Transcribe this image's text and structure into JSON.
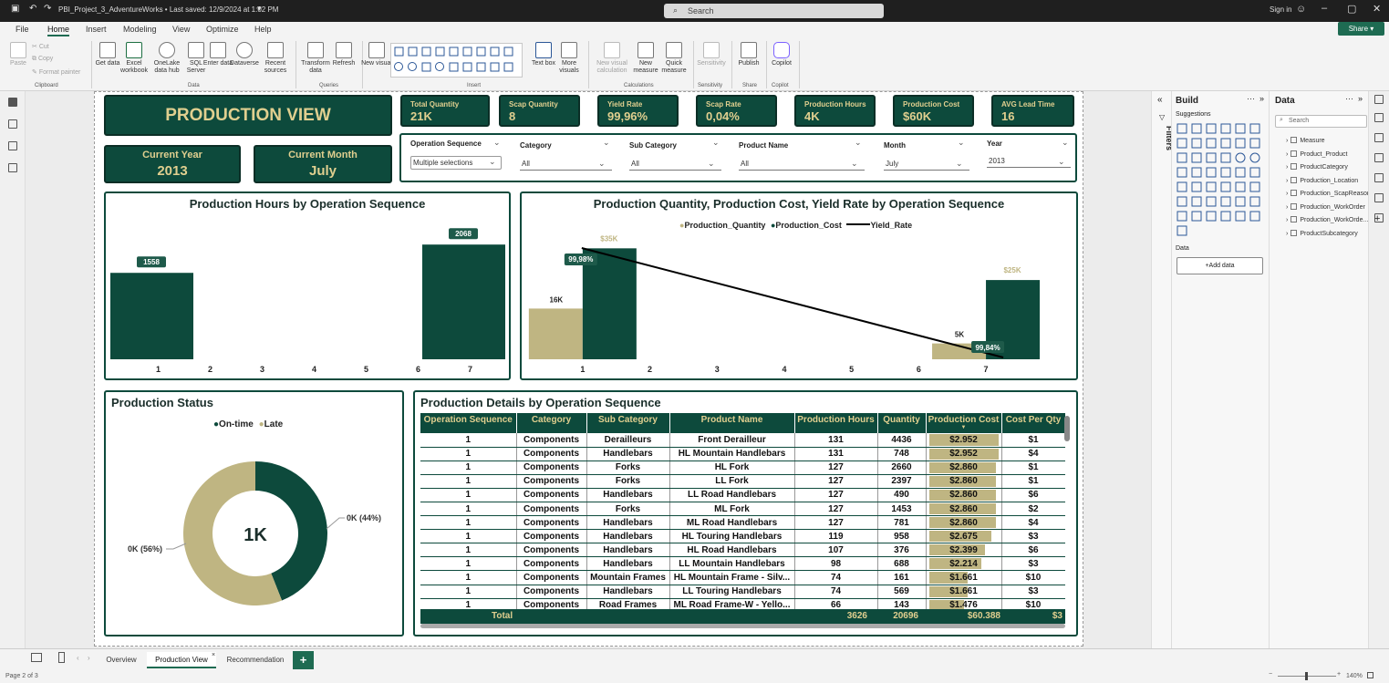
{
  "titlebar": {
    "file_title": "PBI_Project_3_AdventureWorks • Last saved: 12/9/2024 at 1:02 PM",
    "search_placeholder": "Search",
    "signin": "Sign in"
  },
  "menu": [
    "File",
    "Home",
    "Insert",
    "Modeling",
    "View",
    "Optimize",
    "Help"
  ],
  "share_label": "Share",
  "ribbon": {
    "paste": "Paste",
    "cut": "Cut",
    "copy": "Copy",
    "format_painter": "Format painter",
    "get_data": "Get data",
    "excel": "Excel workbook",
    "onelake": "OneLake data hub",
    "sql": "SQL Server",
    "enter_data": "Enter data",
    "dataverse": "Dataverse",
    "recent": "Recent sources",
    "transform": "Transform data",
    "refresh": "Refresh",
    "new_visual": "New visual",
    "text_box": "Text box",
    "more_visuals": "More visuals",
    "new_visual_calc": "New visual calculation",
    "new_measure": "New measure",
    "quick_measure": "Quick measure",
    "sensitivity": "Sensitivity",
    "publish": "Publish",
    "copilot": "Copilot",
    "groups": [
      "Clipboard",
      "Data",
      "Queries",
      "Insert",
      "Calculations",
      "Sensitivity",
      "Share",
      "Copilot"
    ]
  },
  "report": {
    "page_title": "PRODUCTION VIEW",
    "current_year_label": "Current Year",
    "current_year": "2013",
    "current_month_label": "Current Month",
    "current_month": "July",
    "kpis": [
      {
        "label": "Total Quantity",
        "value": "21K"
      },
      {
        "label": "Scap Quantity",
        "value": "8"
      },
      {
        "label": "Yield Rate",
        "value": "99,96%"
      },
      {
        "label": "Scap Rate",
        "value": "0,04%"
      },
      {
        "label": "Production Hours",
        "value": "4K"
      },
      {
        "label": "Production Cost",
        "value": "$60K"
      },
      {
        "label": "AVG Lead Time",
        "value": "16"
      }
    ],
    "slicers": [
      {
        "label": "Operation Sequence",
        "value": "Multiple selections"
      },
      {
        "label": "Category",
        "value": "All"
      },
      {
        "label": "Sub Category",
        "value": "All"
      },
      {
        "label": "Product Name",
        "value": "All"
      },
      {
        "label": "Month",
        "value": "July"
      },
      {
        "label": "Year",
        "value": "2013"
      }
    ],
    "hours_title": "Production Hours by Operation Sequence",
    "combo_title": "Production Quantity, Production Cost, Yield Rate by Operation Sequence",
    "combo_legend": [
      "Production_Quantity",
      "Production_Cost",
      "Yield_Rate"
    ],
    "status_title": "Production Status",
    "status_legend": [
      "On-time",
      "Late"
    ],
    "details_title": "Production Details by Operation Sequence",
    "colors": {
      "dark_green": "#0d4a3c",
      "gold": "#e0cf8f",
      "tan": "#bfb582"
    }
  },
  "chart_data": [
    {
      "type": "bar",
      "title": "Production Hours by Operation Sequence",
      "categories": [
        "1",
        "2",
        "3",
        "4",
        "5",
        "6",
        "7"
      ],
      "values": [
        1558,
        null,
        null,
        null,
        null,
        null,
        2068
      ],
      "data_labels": [
        "1558",
        "",
        "",
        "",
        "",
        "",
        "2068"
      ],
      "ylim": [
        0,
        2400
      ]
    },
    {
      "type": "bar",
      "title": "Production Quantity, Production Cost, Yield Rate by Operation Sequence",
      "categories": [
        "1",
        "2",
        "3",
        "4",
        "5",
        "6",
        "7"
      ],
      "series": [
        {
          "name": "Production_Quantity",
          "values": [
            16000,
            null,
            null,
            null,
            null,
            null,
            5000
          ],
          "labels": [
            "16K",
            "",
            "",
            "",
            "",
            "",
            "5K"
          ]
        },
        {
          "name": "Production_Cost",
          "values": [
            35000,
            null,
            null,
            null,
            null,
            null,
            25000
          ],
          "labels": [
            "$35K",
            "",
            "",
            "",
            "",
            "",
            "$25K"
          ]
        },
        {
          "name": "Yield_Rate",
          "values": [
            99.98,
            null,
            null,
            null,
            null,
            null,
            99.84
          ],
          "labels": [
            "99,98%",
            "",
            "",
            "",
            "",
            "",
            "99,84%"
          ]
        }
      ],
      "ylim": [
        0,
        42000
      ],
      "legend": "top"
    },
    {
      "type": "pie",
      "title": "Production Status",
      "categories": [
        "On-time",
        "Late"
      ],
      "values": [
        44,
        56
      ],
      "labels": [
        "0K (44%)",
        "0K (56%)"
      ],
      "center_label": "1K",
      "legend": "top"
    },
    {
      "type": "table",
      "title": "Production Details by Operation Sequence",
      "columns": [
        "Operation Sequence",
        "Category",
        "Sub Category",
        "Product Name",
        "Production Hours",
        "Quantity",
        "Production Cost",
        "Cost Per Qty"
      ],
      "rows": [
        [
          "1",
          "Components",
          "Derailleurs",
          "Front Derailleur",
          "131",
          "4436",
          "$2.952",
          "$1"
        ],
        [
          "1",
          "Components",
          "Handlebars",
          "HL Mountain Handlebars",
          "131",
          "748",
          "$2.952",
          "$4"
        ],
        [
          "1",
          "Components",
          "Forks",
          "HL Fork",
          "127",
          "2660",
          "$2.860",
          "$1"
        ],
        [
          "1",
          "Components",
          "Forks",
          "LL Fork",
          "127",
          "2397",
          "$2.860",
          "$1"
        ],
        [
          "1",
          "Components",
          "Handlebars",
          "LL Road Handlebars",
          "127",
          "490",
          "$2.860",
          "$6"
        ],
        [
          "1",
          "Components",
          "Forks",
          "ML Fork",
          "127",
          "1453",
          "$2.860",
          "$2"
        ],
        [
          "1",
          "Components",
          "Handlebars",
          "ML Road Handlebars",
          "127",
          "781",
          "$2.860",
          "$4"
        ],
        [
          "1",
          "Components",
          "Handlebars",
          "HL Touring Handlebars",
          "119",
          "958",
          "$2.675",
          "$3"
        ],
        [
          "1",
          "Components",
          "Handlebars",
          "HL Road Handlebars",
          "107",
          "376",
          "$2.399",
          "$6"
        ],
        [
          "1",
          "Components",
          "Handlebars",
          "LL Mountain Handlebars",
          "98",
          "688",
          "$2.214",
          "$3"
        ],
        [
          "1",
          "Components",
          "Mountain Frames",
          "HL Mountain Frame - Silv...",
          "74",
          "161",
          "$1.661",
          "$10"
        ],
        [
          "1",
          "Components",
          "Handlebars",
          "LL Touring Handlebars",
          "74",
          "569",
          "$1.661",
          "$3"
        ],
        [
          "1",
          "Components",
          "Road Frames",
          "ML Road Frame-W - Yello...",
          "66",
          "143",
          "$1.476",
          "$10"
        ]
      ],
      "cost_values": [
        2952,
        2952,
        2860,
        2860,
        2860,
        2860,
        2860,
        2675,
        2399,
        2214,
        1661,
        1661,
        1476
      ],
      "total": {
        "label": "Total",
        "hours": "3626",
        "quantity": "20696",
        "cost": "$60.388",
        "cost_per_qty": "$3"
      }
    }
  ],
  "build_pane": {
    "title": "Build",
    "suggestions": "Suggestions",
    "data_label": "Data",
    "add_data": "+Add data"
  },
  "filters_label": "Filters",
  "data_pane": {
    "title": "Data",
    "search_placeholder": "Search",
    "tables": [
      "Measure",
      "Product_Product",
      "ProductCategory",
      "Production_Location",
      "Production_ScapReason",
      "Production_WorkOrder",
      "Production_WorkOrde...",
      "ProductSubcategory"
    ]
  },
  "page_tabs": [
    "Overview",
    "Production View",
    "Recommendation"
  ],
  "status": {
    "page": "Page 2 of 3",
    "zoom": "140%"
  }
}
